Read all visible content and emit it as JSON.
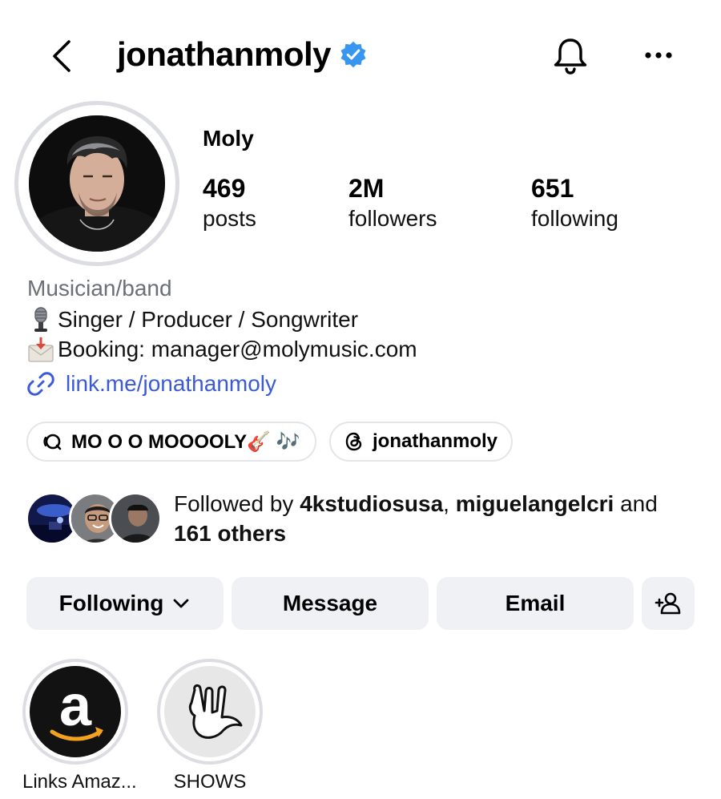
{
  "header": {
    "username": "jonathanmoly",
    "verified": true,
    "back_icon": "chevron-left-icon",
    "bell_icon": "bell-icon",
    "more_icon": "more-horizontal-icon"
  },
  "profile": {
    "display_name": "Moly",
    "stats": [
      {
        "value": "469",
        "label": "posts"
      },
      {
        "value": "2M",
        "label": "followers"
      },
      {
        "value": "651",
        "label": "following"
      }
    ],
    "category": "Musician/band",
    "bio": [
      {
        "icon": "microphone-emoji",
        "text": "Singer / Producer / Songwriter"
      },
      {
        "icon": "envelope-arrow-emoji",
        "text": "Booking: manager@molymusic.com"
      }
    ],
    "link": "link.me/jonathanmoly",
    "pills": [
      {
        "icon": "threads-chat-icon",
        "text": "MO O O MOOOOLY🎸 🎶"
      },
      {
        "icon": "threads-icon",
        "text": "jonathanmoly"
      }
    ]
  },
  "followed_by": {
    "prefix": "Followed by ",
    "user1": "4kstudiosusa",
    "sep": ", ",
    "user2": "miguelangelcri",
    "and": " and",
    "others": "161 others"
  },
  "actions": {
    "following": "Following",
    "message": "Message",
    "email": "Email"
  },
  "highlights": [
    {
      "label": "Links Amaz..."
    },
    {
      "label": "SHOWS"
    }
  ],
  "colors": {
    "verified": "#3797f0",
    "link": "#3b5bd6",
    "button_bg": "#eff1f4",
    "muted": "#6b6f76",
    "amazon_orange": "#f4a21d"
  }
}
